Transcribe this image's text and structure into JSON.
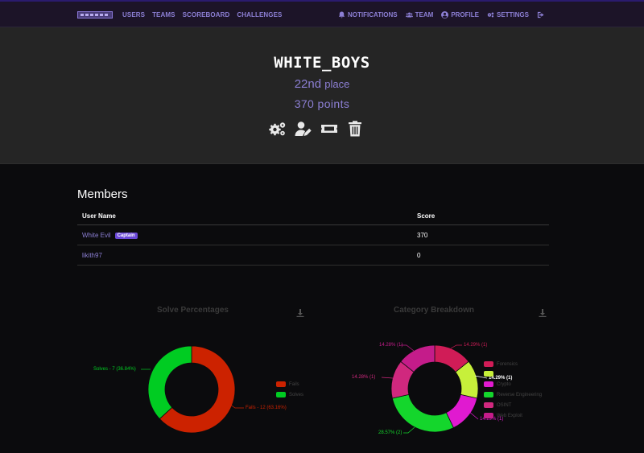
{
  "navbar": {
    "left_links": [
      "USERS",
      "TEAMS",
      "SCOREBOARD",
      "CHALLENGES"
    ],
    "right_links": [
      {
        "label": "NOTIFICATIONS",
        "icon": "bell-icon"
      },
      {
        "label": "TEAM",
        "icon": "users-icon"
      },
      {
        "label": "PROFILE",
        "icon": "user-circle-icon"
      },
      {
        "label": "SETTINGS",
        "icon": "cogs-icon"
      }
    ],
    "logout_icon": "sign-out-icon"
  },
  "team": {
    "name": "WHITE_BOYS",
    "place_number": "22nd",
    "place_suffix": "place",
    "points": "370 points"
  },
  "actions": [
    "settings-icon",
    "user-edit-icon",
    "ticket-icon",
    "trash-icon"
  ],
  "members": {
    "title": "Members",
    "columns": [
      "User Name",
      "Score"
    ],
    "rows": [
      {
        "name": "White Evil",
        "badge": "Captain",
        "score": "370"
      },
      {
        "name": "likith97",
        "badge": "",
        "score": "0"
      }
    ]
  },
  "colors": {
    "accent": "#8c7fd4",
    "fails": "#cc2200",
    "solves": "#00cc22",
    "captain_badge": "#6a48d7"
  },
  "chart_data": [
    {
      "type": "pie",
      "title": "Solve Percentages",
      "slices": [
        {
          "name": "Fails",
          "value": 12,
          "percent": 63.16,
          "label": "Fails - 12 (63.16%)",
          "color": "#cc2200"
        },
        {
          "name": "Solves",
          "value": 7,
          "percent": 36.84,
          "label": "Solves - 7 (36.84%)",
          "color": "#00cc22"
        }
      ],
      "legend": [
        "Fails",
        "Solves"
      ],
      "legend_placement": "right"
    },
    {
      "type": "pie",
      "title": "Category Breakdown",
      "slices": [
        {
          "name": "Forensics",
          "value": 1,
          "percent": 14.29,
          "label": "14.29% (1)",
          "color": "#d01c57"
        },
        {
          "name": "",
          "value": 1,
          "percent": 14.29,
          "label": "14.29% (1)",
          "color": "#c7f03a"
        },
        {
          "name": "Crypto",
          "value": 1,
          "percent": 14.29,
          "label": "14.29% (1)",
          "color": "#e01ad0"
        },
        {
          "name": "Reverse Engineering",
          "value": 2,
          "percent": 28.57,
          "label": "28.57% (2)",
          "color": "#14d62c"
        },
        {
          "name": "OSINT",
          "value": 1,
          "percent": 14.28,
          "label": "14.28% (1)",
          "color": "#d0287e"
        },
        {
          "name": "Web Exploit",
          "value": 1,
          "percent": 14.28,
          "label": "14.28% (1)",
          "color": "#c41c8a"
        }
      ],
      "legend": [
        "Forensics",
        "",
        "Crypto",
        "Reverse Engineering",
        "OSINT",
        "Web Exploit"
      ],
      "legend_placement": "right"
    }
  ]
}
